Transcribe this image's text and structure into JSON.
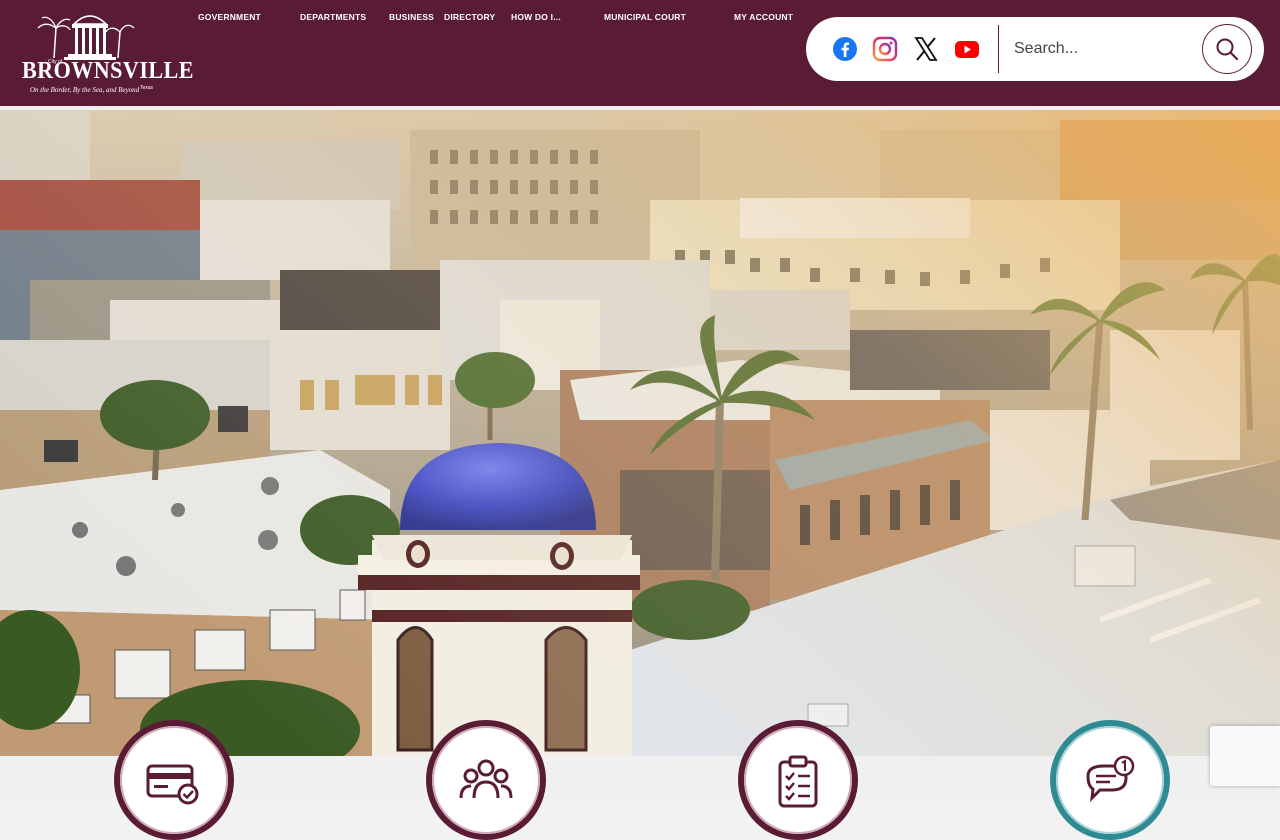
{
  "logo": {
    "name": "BROWNSVILLE",
    "city_of": "City of",
    "state": "Texas",
    "tagline": "On the Border, By the Sea, and Beyond"
  },
  "nav": {
    "items": [
      {
        "label": "GOVERNMENT"
      },
      {
        "label": "DEPARTMENTS"
      },
      {
        "label": "BUSINESS"
      },
      {
        "label": "DIRECTORY"
      },
      {
        "label": "HOW DO I..."
      },
      {
        "label": "MUNICIPAL COURT"
      },
      {
        "label": "MY ACCOUNT"
      }
    ]
  },
  "social": {
    "icons": [
      "facebook-icon",
      "instagram-icon",
      "x-icon",
      "youtube-icon"
    ]
  },
  "search": {
    "placeholder": "Search..."
  },
  "colors": {
    "brand": "#5a1b35",
    "accent_teal": "#2e8a93"
  },
  "quick_links": {
    "icons": [
      "payment-card-icon",
      "community-people-icon",
      "checklist-icon",
      "notification-chat-icon"
    ]
  }
}
